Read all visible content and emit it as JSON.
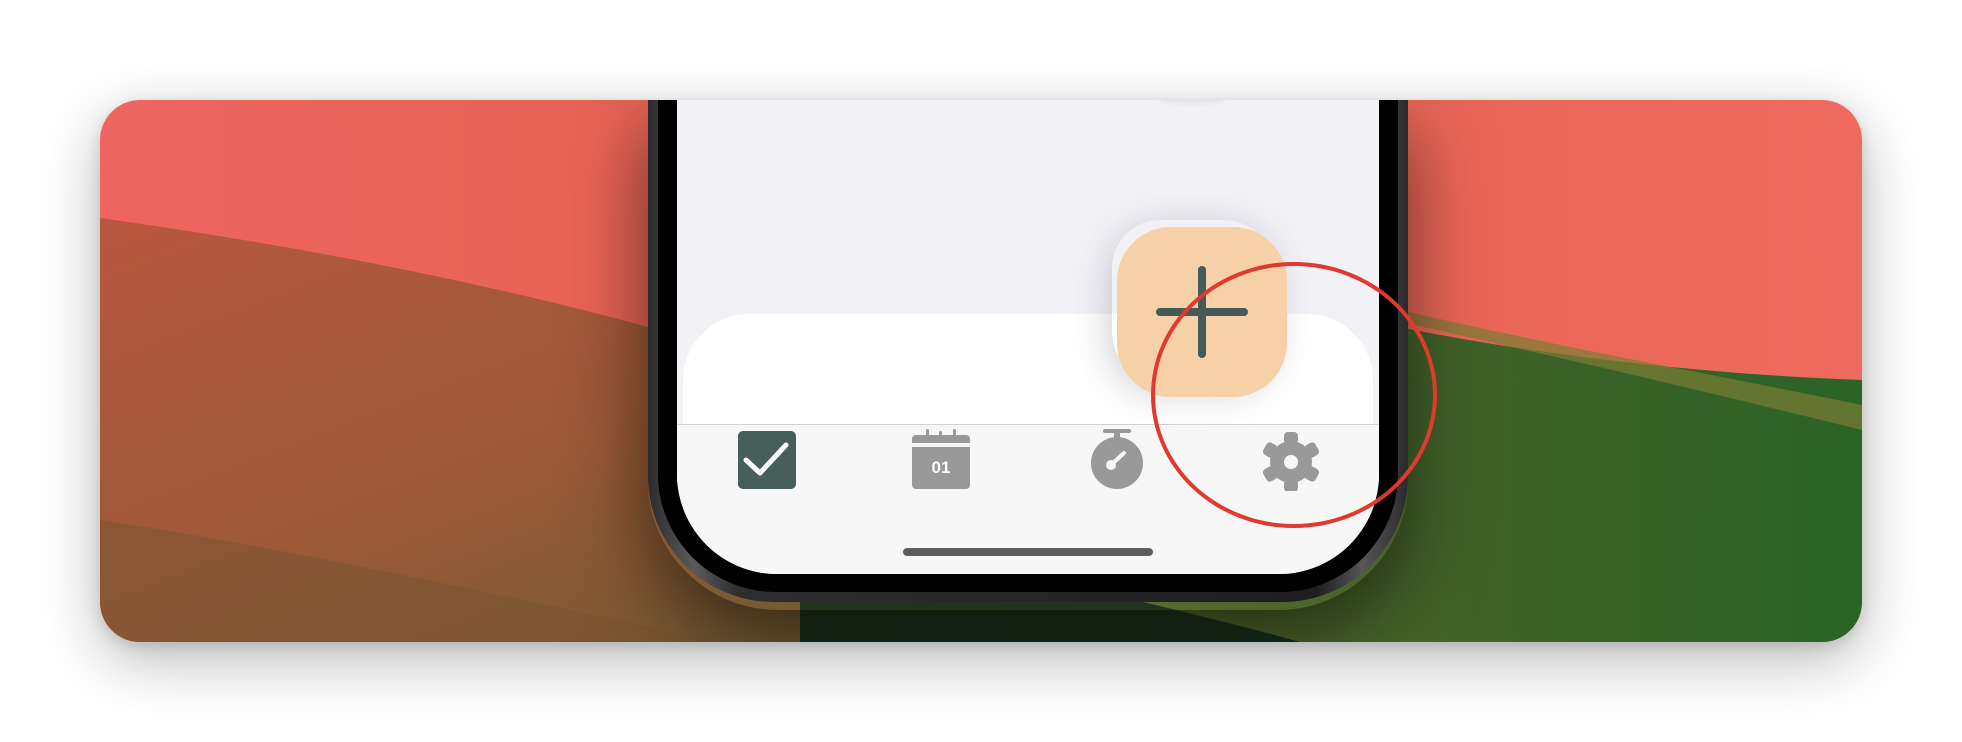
{
  "wallpaper": {
    "colors": {
      "coral": "#ee6560",
      "rust": "#b5573f",
      "olive": "#6a6a30",
      "green": "#2b6327",
      "dark_green": "#1c3420"
    }
  },
  "fab": {
    "icon": "plus-icon",
    "color": "#f6d1a8",
    "icon_color": "#465b58"
  },
  "highlight": {
    "color": "#e03a2e"
  },
  "tabbar": {
    "tabs": [
      {
        "name": "tab-tasks",
        "icon": "checkmark-icon",
        "active": true,
        "color": "#465f5a"
      },
      {
        "name": "tab-calendar",
        "icon": "calendar-icon",
        "active": false,
        "color": "#999999",
        "label": "01"
      },
      {
        "name": "tab-timer",
        "icon": "stopwatch-icon",
        "active": false,
        "color": "#999999"
      },
      {
        "name": "tab-settings",
        "icon": "gear-icon",
        "active": false,
        "color": "#999999"
      }
    ]
  }
}
